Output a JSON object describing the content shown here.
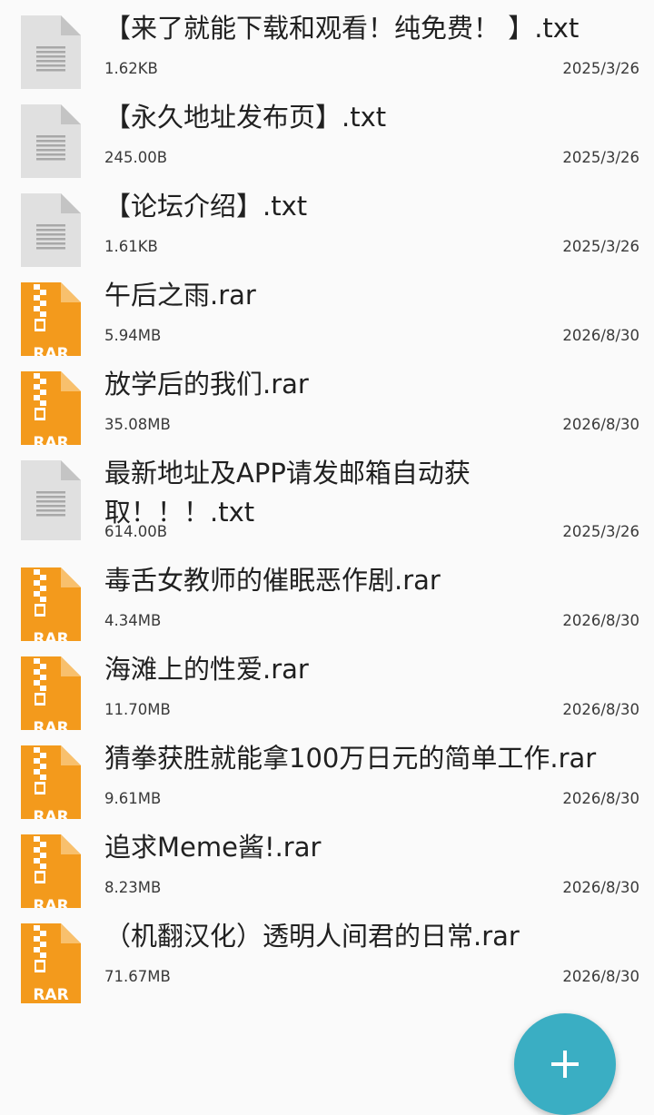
{
  "files": [
    {
      "name": "【来了就能下载和观看！纯免费！ 】.txt",
      "size": "1.62KB",
      "date": "2025/3/26",
      "type": "txt"
    },
    {
      "name": "【永久地址发布页】.txt",
      "size": "245.00B",
      "date": "2025/3/26",
      "type": "txt"
    },
    {
      "name": "【论坛介绍】.txt",
      "size": "1.61KB",
      "date": "2025/3/26",
      "type": "txt"
    },
    {
      "name": "午后之雨.rar",
      "size": "5.94MB",
      "date": "2026/8/30",
      "type": "rar"
    },
    {
      "name": "放学后的我们.rar",
      "size": "35.08MB",
      "date": "2026/8/30",
      "type": "rar"
    },
    {
      "name": "最新地址及APP请发邮箱自动获取！！！.txt",
      "size": "614.00B",
      "date": "2025/3/26",
      "type": "txt"
    },
    {
      "name": "毒舌女教师的催眠恶作剧.rar",
      "size": "4.34MB",
      "date": "2026/8/30",
      "type": "rar"
    },
    {
      "name": "海滩上的性爱.rar",
      "size": "11.70MB",
      "date": "2026/8/30",
      "type": "rar"
    },
    {
      "name": "猜拳获胜就能拿100万日元的简单工作.rar",
      "size": "9.61MB",
      "date": "2026/8/30",
      "type": "rar"
    },
    {
      "name": "追求Meme酱!.rar",
      "size": "8.23MB",
      "date": "2026/8/30",
      "type": "rar"
    },
    {
      "name": "（机翻汉化）透明人间君的日常.rar",
      "size": "71.67MB",
      "date": "2026/8/30",
      "type": "rar"
    }
  ],
  "icons": {
    "txt": "text-file-icon",
    "rar": "rar-archive-icon",
    "rar_label": "RAR",
    "fab": "add-icon"
  },
  "colors": {
    "rar_orange": "#f39a1c",
    "rar_fold": "#f8c06d",
    "txt_gray": "#e0e0e0",
    "txt_fold": "#c4c4c4",
    "fab": "#3aaec3",
    "text": "#202020",
    "meta_text": "#3a3a3a"
  }
}
